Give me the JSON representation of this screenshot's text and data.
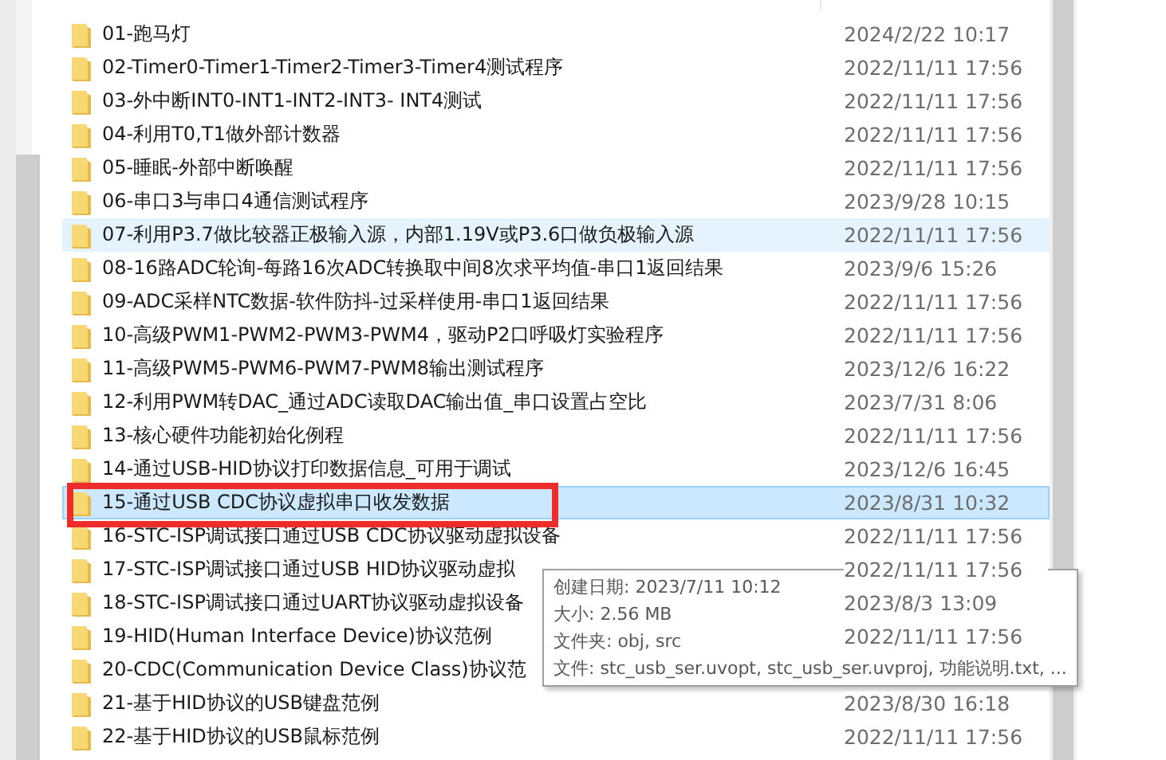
{
  "files": [
    {
      "name": "01-跑马灯",
      "date": "2024/2/22 10:17",
      "hovered": false,
      "selected": false
    },
    {
      "name": "02-Timer0-Timer1-Timer2-Timer3-Timer4测试程序",
      "date": "2022/11/11 17:56",
      "hovered": false,
      "selected": false
    },
    {
      "name": "03-外中断INT0-INT1-INT2-INT3- INT4测试",
      "date": "2022/11/11 17:56",
      "hovered": false,
      "selected": false
    },
    {
      "name": "04-利用T0,T1做外部计数器",
      "date": "2022/11/11 17:56",
      "hovered": false,
      "selected": false
    },
    {
      "name": "05-睡眠-外部中断唤醒",
      "date": "2022/11/11 17:56",
      "hovered": false,
      "selected": false
    },
    {
      "name": "06-串口3与串口4通信测试程序",
      "date": "2023/9/28 10:15",
      "hovered": false,
      "selected": false
    },
    {
      "name": "07-利用P3.7做比较器正极输入源，内部1.19V或P3.6口做负极输入源",
      "date": "2022/11/11 17:56",
      "hovered": true,
      "selected": false
    },
    {
      "name": "08-16路ADC轮询-每路16次ADC转换取中间8次求平均值-串口1返回结果",
      "date": "2023/9/6 15:26",
      "hovered": false,
      "selected": false
    },
    {
      "name": "09-ADC采样NTC数据-软件防抖-过采样使用-串口1返回结果",
      "date": "2022/11/11 17:56",
      "hovered": false,
      "selected": false
    },
    {
      "name": "10-高级PWM1-PWM2-PWM3-PWM4，驱动P2口呼吸灯实验程序",
      "date": "2022/11/11 17:56",
      "hovered": false,
      "selected": false
    },
    {
      "name": "11-高级PWM5-PWM6-PWM7-PWM8输出测试程序",
      "date": "2023/12/6 16:22",
      "hovered": false,
      "selected": false
    },
    {
      "name": "12-利用PWM转DAC_通过ADC读取DAC输出值_串口设置占空比",
      "date": "2023/7/31 8:06",
      "hovered": false,
      "selected": false
    },
    {
      "name": "13-核心硬件功能初始化例程",
      "date": "2022/11/11 17:56",
      "hovered": false,
      "selected": false
    },
    {
      "name": "14-通过USB-HID协议打印数据信息_可用于调试",
      "date": "2023/12/6 16:45",
      "hovered": false,
      "selected": false
    },
    {
      "name": "15-通过USB CDC协议虚拟串口收发数据",
      "date": "2023/8/31 10:32",
      "hovered": false,
      "selected": true
    },
    {
      "name": "16-STC-ISP调试接口通过USB CDC协议驱动虚拟设备",
      "date": "2022/11/11 17:56",
      "hovered": false,
      "selected": false
    },
    {
      "name": "17-STC-ISP调试接口通过USB HID协议驱动虚拟",
      "date": "2022/11/11 17:56",
      "hovered": false,
      "selected": false
    },
    {
      "name": "18-STC-ISP调试接口通过UART协议驱动虚拟设备",
      "date": "2023/8/3 13:09",
      "hovered": false,
      "selected": false
    },
    {
      "name": "19-HID(Human Interface Device)协议范例",
      "date": "2022/11/11 17:56",
      "hovered": false,
      "selected": false
    },
    {
      "name": "20-CDC(Communication Device Class)协议范",
      "hovered": false,
      "selected": false
    },
    {
      "name": "21-基于HID协议的USB键盘范例",
      "date": "2023/8/30 16:18",
      "hovered": false,
      "selected": false
    },
    {
      "name": "22-基于HID协议的USB鼠标范例",
      "date": "2022/11/11 17:56",
      "hovered": false,
      "selected": false
    }
  ],
  "tooltip": {
    "lines": [
      "创建日期: 2023/7/11 10:12",
      "大小: 2.56 MB",
      "文件夹: obj, src",
      "文件: stc_usb_ser.uvopt, stc_usb_ser.uvproj, 功能说明.txt, ..."
    ]
  }
}
